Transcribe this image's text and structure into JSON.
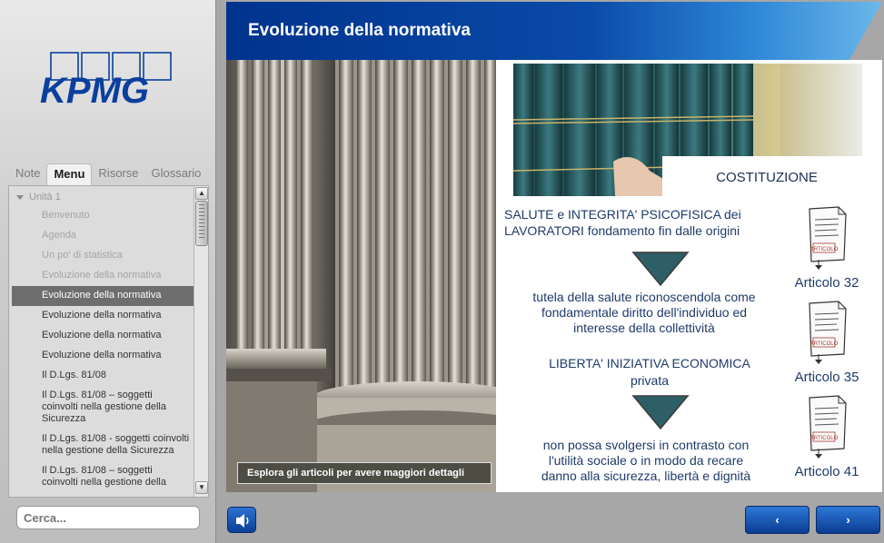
{
  "sidebar": {
    "logo_text": "KPMG",
    "tabs": [
      {
        "label": "Note"
      },
      {
        "label": "Menu"
      },
      {
        "label": "Risorse"
      },
      {
        "label": "Glossario"
      }
    ],
    "unit_label": "Unità 1",
    "menu_items": [
      {
        "label": "Benvenuto",
        "state": "disabled"
      },
      {
        "label": "Agenda",
        "state": "disabled"
      },
      {
        "label": "Un po' di statistica",
        "state": "disabled"
      },
      {
        "label": "Evoluzione della normativa",
        "state": "disabled"
      },
      {
        "label": "Evoluzione della normativa",
        "state": "active"
      },
      {
        "label": "Evoluzione della normativa",
        "state": "normal"
      },
      {
        "label": "Evoluzione della normativa",
        "state": "normal"
      },
      {
        "label": "Evoluzione della normativa",
        "state": "normal"
      },
      {
        "label": "Il D.Lgs. 81/08",
        "state": "normal"
      },
      {
        "label": "Il D.Lgs. 81/08 – soggetti coinvolti nella gestione della Sicurezza",
        "state": "normal"
      },
      {
        "label": "Il D.Lgs. 81/08 - soggetti coinvolti nella gestione della Sicurezza",
        "state": "normal"
      },
      {
        "label": "Il D.Lgs. 81/08 – soggetti coinvolti nella gestione della",
        "state": "normal"
      }
    ],
    "scroll_up_icon": "arrow-up-icon",
    "scroll_down_icon": "arrow-down-icon",
    "search_placeholder": "Cerca..."
  },
  "header": {
    "title": "Evoluzione della normativa"
  },
  "content": {
    "caption": "Esplora gli articoli per avere maggiori dettagli",
    "costituzione": "COSTITUZIONE",
    "block1_line1": "SALUTE e INTEGRITA' PSICOFISICA  dei",
    "block1_line2": "LAVORATORI fondamento  fin dalle origini",
    "block2_line1": "tutela della salute riconoscendola come",
    "block2_line2": "fondamentale diritto dell'individuo ed",
    "block2_line3": "interesse della collettività",
    "block3_line1": "LIBERTA' INIZIATIVA ECONOMICA",
    "block3_line2": "privata",
    "block4_line1": "non possa svolgersi in contrasto con",
    "block4_line2": "l'utilità sociale o in modo da recare",
    "block4_line3": "danno alla sicurezza, libertà e dignità",
    "document_stamp": "ARTICOLO",
    "articles": [
      {
        "label": "Articolo 32"
      },
      {
        "label": "Articolo 35"
      },
      {
        "label": "Articolo 41"
      }
    ],
    "arrow_color": "#2e5f66"
  },
  "footer": {
    "audio_icon": "speaker-icon",
    "prev_label": "‹",
    "next_label": "›"
  }
}
